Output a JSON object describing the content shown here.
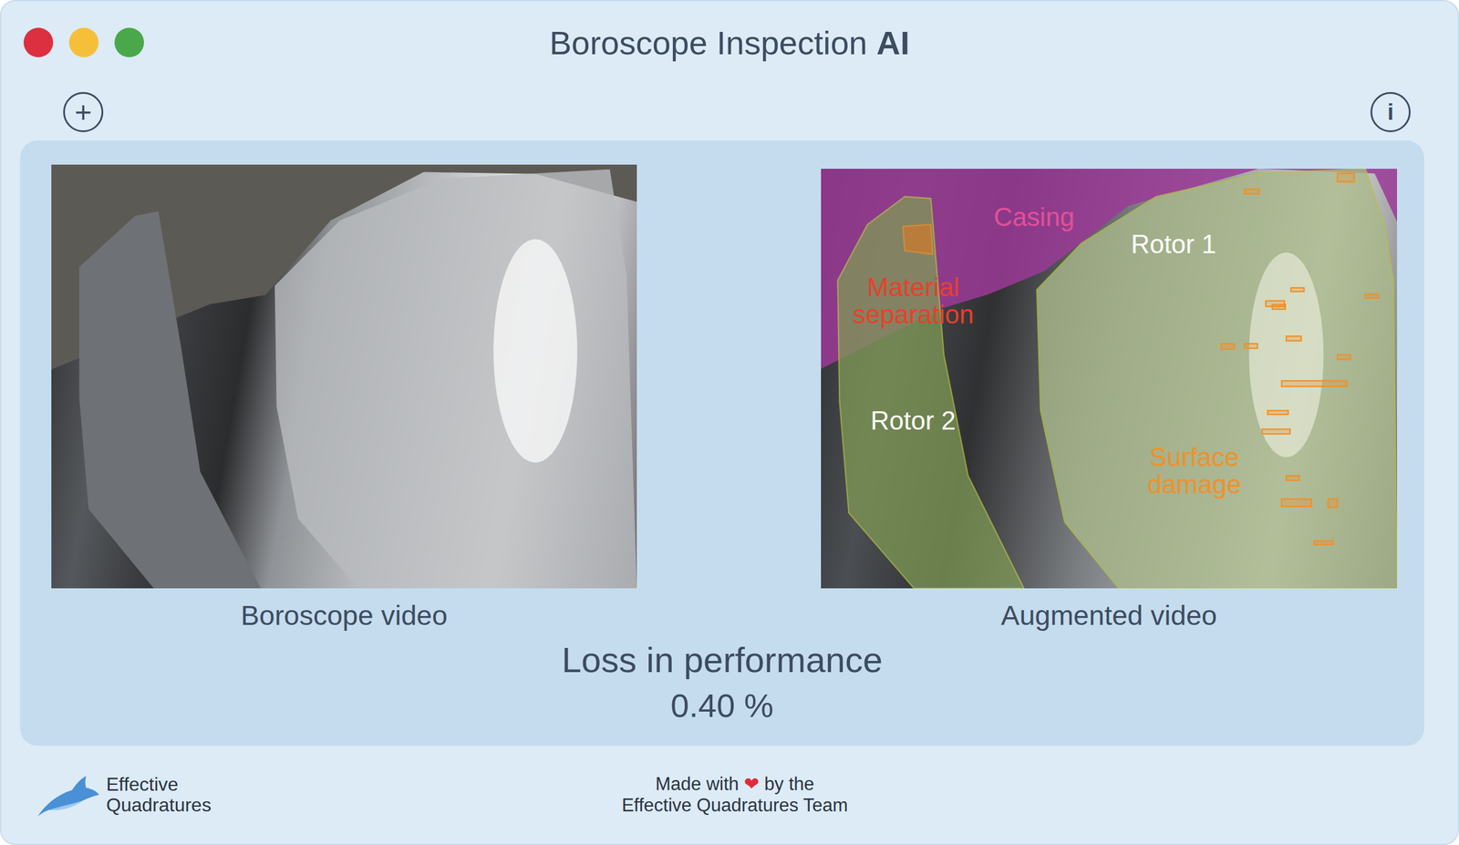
{
  "window": {
    "title": "Boroscope Inspection",
    "title_strong": "AI"
  },
  "toolbar": {
    "add": "+",
    "info": "i"
  },
  "videos": [
    {
      "caption": "Boroscope video",
      "kind": "raw"
    },
    {
      "caption": "Augmented video",
      "kind": "augmented"
    }
  ],
  "annotations": [
    {
      "text": "Casing",
      "color": "#e0509a"
    },
    {
      "text": "Rotor 1",
      "color": "#ffffff"
    },
    {
      "text": "Material\nseparation",
      "color": "#e8402a"
    },
    {
      "text": "Rotor 2",
      "color": "#ffffff"
    },
    {
      "text": "Surface\ndamage",
      "color": "#f0902a"
    }
  ],
  "metric": {
    "label": "Loss in performance",
    "value": "0.40 %"
  },
  "footer": {
    "brand": "Effective\nQuadratures",
    "credit_prefix": "Made with",
    "heart": "❤",
    "credit_suffix": "by the",
    "team": "Effective Quadratures Team"
  }
}
